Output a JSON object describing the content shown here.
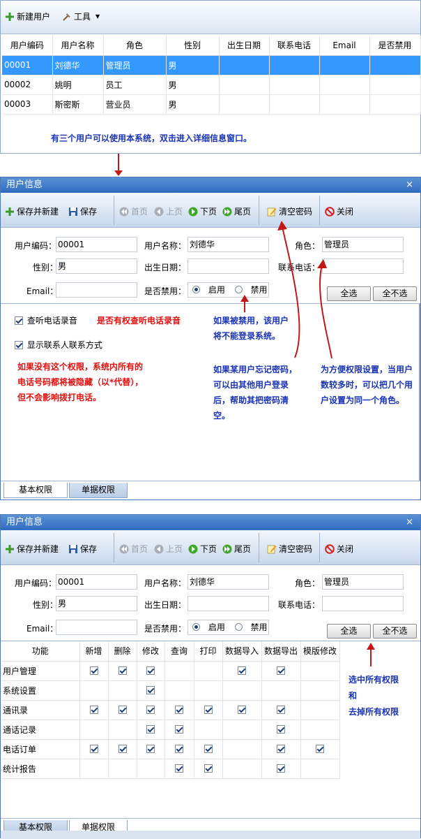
{
  "list": {
    "toolbar": {
      "new_user": "新建用户",
      "tools": "工具"
    },
    "columns": [
      "用户编码",
      "用户名称",
      "角色",
      "性别",
      "出生日期",
      "联系电话",
      "Email",
      "是否禁用"
    ],
    "rows": [
      [
        "00001",
        "刘德华",
        "管理员",
        "男",
        "",
        "",
        "",
        ""
      ],
      [
        "00002",
        "姚明",
        "员工",
        "男",
        "",
        "",
        "",
        ""
      ],
      [
        "00003",
        "斯密斯",
        "营业员",
        "男",
        "",
        "",
        "",
        ""
      ]
    ]
  },
  "annotations": {
    "list_note": "有三个用户可以使用本系统，双击进入详细信息窗口。",
    "phone_record_note": "是否有权查听电话录音",
    "disabled_note": "如果被禁用，该用户将不能登录系统。",
    "contact_note": "如果没有这个权限，系统内所有的电话号码都将被隐藏（以*代替），但不会影响拨打电话。",
    "password_note": "如果某用户忘记密码，可以由其他用户登录后，帮助其把密码清空。",
    "role_note": "为方便权限设置，当用户数较多时，可以把几个用户设置为同一个角色。",
    "select_note": [
      "选中所有权限",
      "和",
      "去掉所有权限"
    ]
  },
  "dialog": {
    "title": "用户信息",
    "close": "×",
    "toolbar": {
      "save_new": "保存并新建",
      "save": "保存",
      "first": "首页",
      "prev": "上页",
      "next": "下页",
      "last": "尾页",
      "clear_pwd": "清空密码",
      "close": "关闭"
    },
    "form": {
      "code_label": "用户编码：",
      "code_value": "00001",
      "name_label": "用户名称：",
      "name_value": "刘德华",
      "role_label": "角色：",
      "role_value": "管理员",
      "gender_label": "性别：",
      "gender_value": "男",
      "birth_label": "出生日期：",
      "birth_value": "",
      "phone_label": "联系电话：",
      "phone_value": "",
      "email_label": "Email：",
      "email_value": "",
      "disabled_label": "是否禁用：",
      "enabled_option": "启用",
      "disabled_option": "禁用",
      "enabled_selected": true
    },
    "select_all": "全选",
    "deselect_all": "全不选",
    "basic_perms": [
      {
        "label": "查听电话录音",
        "checked": true
      },
      {
        "label": "显示联系人联系方式",
        "checked": true
      }
    ],
    "tabs": [
      "基本权限",
      "单据权限"
    ],
    "perm_columns": [
      "功能",
      "新增",
      "删除",
      "修改",
      "查询",
      "打印",
      "数据导入",
      "数据导出",
      "模版修改"
    ],
    "perm_rows": [
      {
        "name": "用户管理",
        "checks": [
          true,
          true,
          true,
          false,
          false,
          true,
          true,
          false
        ]
      },
      {
        "name": "系统设置",
        "checks": [
          false,
          false,
          true,
          false,
          false,
          false,
          false,
          false
        ]
      },
      {
        "name": "通讯录",
        "checks": [
          true,
          true,
          true,
          true,
          true,
          true,
          true,
          false
        ]
      },
      {
        "name": "通话记录",
        "checks": [
          false,
          false,
          true,
          true,
          false,
          false,
          true,
          false
        ]
      },
      {
        "name": "电话订单",
        "checks": [
          true,
          true,
          true,
          true,
          true,
          false,
          true,
          true
        ]
      },
      {
        "name": "统计报告",
        "checks": [
          false,
          false,
          false,
          true,
          true,
          false,
          true,
          false
        ]
      }
    ]
  },
  "colors": {
    "selected_row": "#3399ff",
    "note_blue": "#1a33b5",
    "note_red": "#e01010",
    "arrow": "#c01818"
  }
}
